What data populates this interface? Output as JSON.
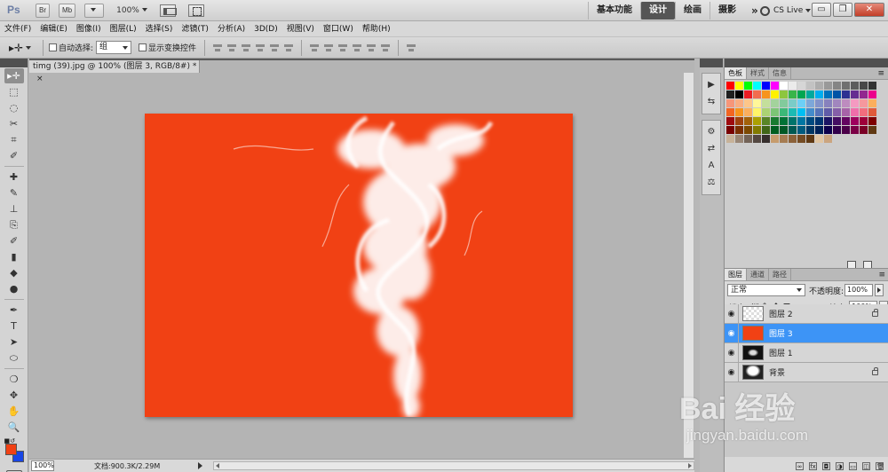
{
  "appbar": {
    "logo": "Ps",
    "bridge_label": "Br",
    "mini_bridge_label": "Mb",
    "zoom": "100%",
    "workspaces": [
      {
        "label": "基本功能",
        "active": false
      },
      {
        "label": "设计",
        "active": true
      },
      {
        "label": "绘画",
        "active": false
      },
      {
        "label": "摄影",
        "active": false
      }
    ],
    "workspaces_more": "»",
    "cs_live": "CS Live",
    "minimize": "▭",
    "restore": "❐",
    "close": "✕"
  },
  "menubar": {
    "items": [
      "文件(F)",
      "编辑(E)",
      "图像(I)",
      "图层(L)",
      "选择(S)",
      "滤镜(T)",
      "分析(A)",
      "3D(D)",
      "视图(V)",
      "窗口(W)",
      "帮助(H)"
    ]
  },
  "options": {
    "auto_select_label": "自动选择:",
    "auto_select_value": "组",
    "show_transform_label": "显示变换控件"
  },
  "tools": {
    "icons": [
      "▸✛",
      "⬚",
      "◌",
      "✂",
      "⌗",
      "✐",
      "✚",
      "✎",
      "⊥",
      "⎘",
      "✐",
      "▮",
      "◆",
      "●",
      "✒",
      "T",
      "➤",
      "⬭",
      "❍",
      "✥",
      "✋",
      "🔍"
    ],
    "foreground_color": "#f14114",
    "background_color": "#1846e6"
  },
  "document": {
    "tab_title": "timg (39).jpg @ 100% (图层 3, RGB/8#) *",
    "tab_close": "×",
    "canvas_color": "#f14114",
    "zoom_field": "100%",
    "status_text": "文档:900.3K/2.29M"
  },
  "dock": {
    "icons_top": [
      "▶",
      "⇆"
    ],
    "icons_bottom": [
      "⚙",
      "⇄",
      "A",
      "⚖"
    ]
  },
  "swatches_panel": {
    "tabs": [
      {
        "label": "色板",
        "active": true
      },
      {
        "label": "样式",
        "active": false
      },
      {
        "label": "信息",
        "active": false
      }
    ],
    "menu": "≡"
  },
  "layers_panel": {
    "tabs": [
      {
        "label": "图层",
        "active": true
      },
      {
        "label": "通道",
        "active": false
      },
      {
        "label": "路径",
        "active": false
      }
    ],
    "menu": "≡",
    "blend_mode": "正常",
    "opacity_label": "不透明度:",
    "opacity_value": "100%",
    "lock_label": "锁定:",
    "fill_label": "填充:",
    "fill_value": "100%",
    "layers": [
      {
        "name": "图层 2",
        "thumb": "checker",
        "selected": false,
        "locked": true
      },
      {
        "name": "图层 3",
        "thumb": "orange",
        "selected": true,
        "locked": false
      },
      {
        "name": "图层 1",
        "thumb": "black",
        "selected": false,
        "locked": false
      },
      {
        "name": "背景",
        "thumb": "dark",
        "selected": false,
        "locked": true
      }
    ],
    "footer_icons": [
      "∞",
      "fx",
      "◘",
      "◑",
      "▭",
      "◫",
      "🗑"
    ]
  },
  "watermark": {
    "line1": "Bai 经验",
    "line2": "jingyan.baidu.com"
  }
}
